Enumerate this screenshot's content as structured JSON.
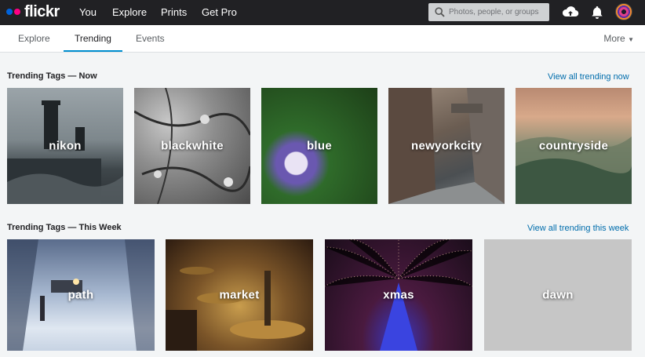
{
  "brand": {
    "name": "flickr"
  },
  "top_nav": {
    "you": "You",
    "explore": "Explore",
    "prints": "Prints",
    "get_pro": "Get Pro"
  },
  "search": {
    "placeholder": "Photos, people, or groups"
  },
  "icons": {
    "upload": "cloud-upload-icon",
    "notifications": "bell-icon",
    "search": "search-icon"
  },
  "sub_nav": {
    "tabs": [
      "Explore",
      "Trending",
      "Events"
    ],
    "active": "Trending",
    "more": "More"
  },
  "sections": [
    {
      "title": "Trending Tags — Now",
      "view_all": "View all trending now",
      "tags": [
        "nikon",
        "blackwhite",
        "blue",
        "newyorkcity",
        "countryside"
      ]
    },
    {
      "title": "Trending Tags — This Week",
      "view_all": "View all trending this week",
      "tags": [
        "path",
        "market",
        "xmas",
        "dawn"
      ]
    }
  ],
  "colors": {
    "topbar": "#212124",
    "accent_tab": "#008ecf",
    "link": "#006dac",
    "brand_blue": "#0063dc",
    "brand_pink": "#ff0084"
  }
}
